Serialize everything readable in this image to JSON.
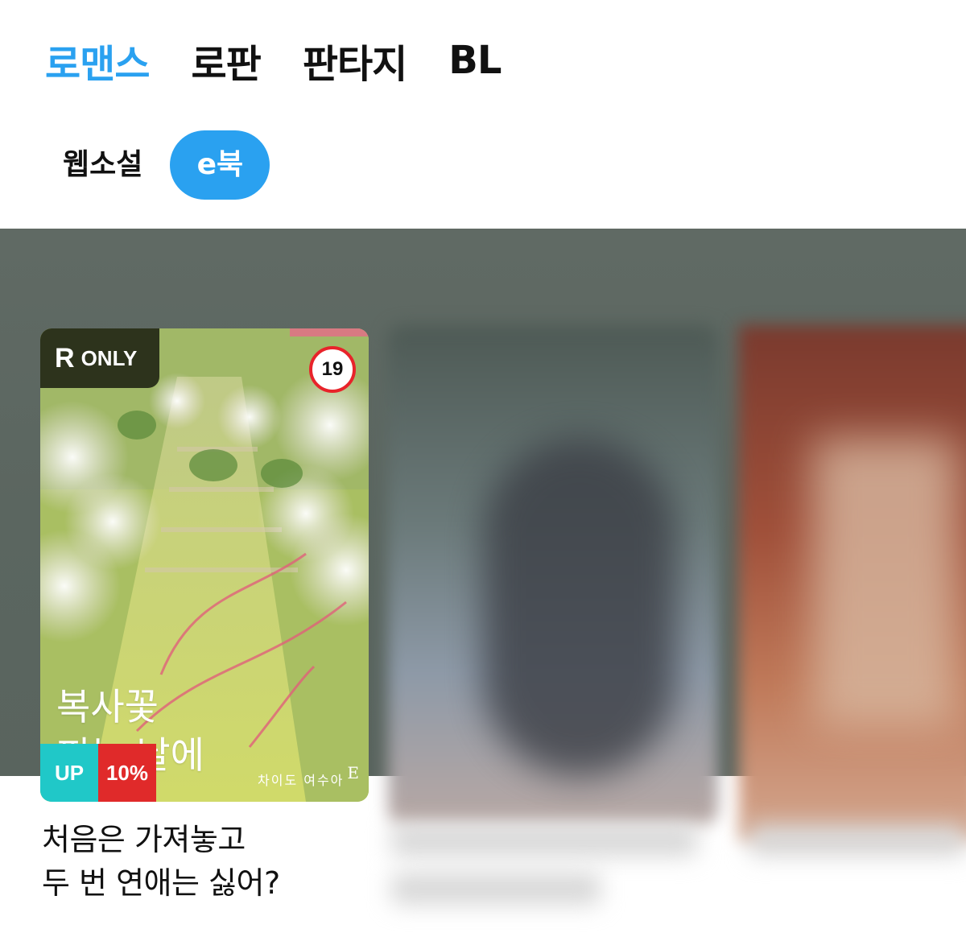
{
  "genre_tabs": [
    {
      "label": "로맨스",
      "active": true
    },
    {
      "label": "로판",
      "active": false
    },
    {
      "label": "판타지",
      "active": false
    },
    {
      "label": "BL",
      "active": false
    }
  ],
  "format_tabs": [
    {
      "label": "웹소설",
      "active": false
    },
    {
      "label": "e북",
      "active": true
    }
  ],
  "featured_book": {
    "badge_r": "R",
    "badge_only": "ONLY",
    "age_rating": "19",
    "cover_title_line1": "복사꽃",
    "cover_title_line2": "피는 날에",
    "cover_authors": "차이도  여수아",
    "cover_publisher": "E",
    "tag_up": "UP",
    "tag_discount": "10%",
    "title_line1": "처음은 가져놓고",
    "title_line2": "두 번 연애는 싫어?"
  },
  "colors": {
    "accent": "#2aa1f0",
    "up_tag": "#20c8c8",
    "discount_tag": "#e02a2a",
    "age_ring": "#e8232a"
  }
}
